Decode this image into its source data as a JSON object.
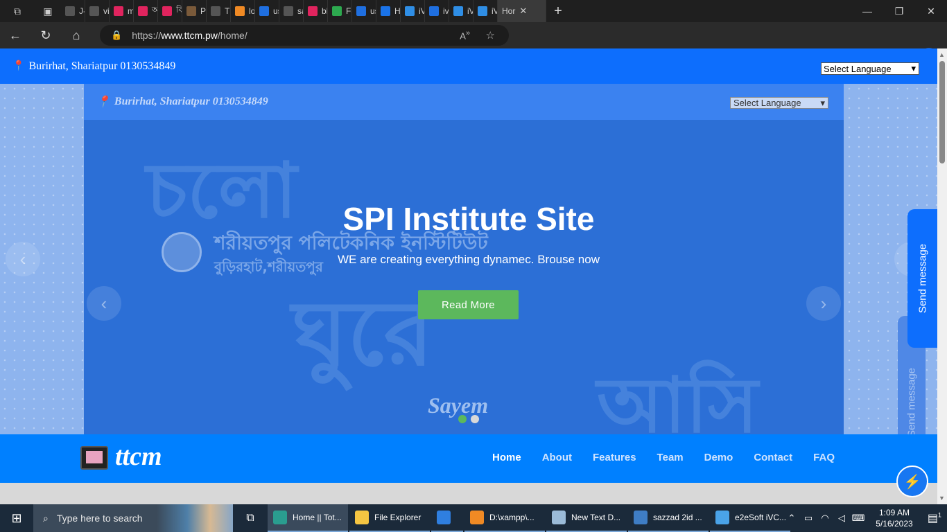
{
  "browser": {
    "tabs": [
      {
        "label": "J-SI",
        "icon": "document-icon",
        "color": "#555555"
      },
      {
        "label": "viev",
        "icon": "document-icon",
        "color": "#555555"
      },
      {
        "label": "mo",
        "icon": "arrow-logo-icon",
        "color": "#e0245e"
      },
      {
        "label": "অন",
        "icon": "arrow-logo-icon",
        "color": "#e0245e"
      },
      {
        "label": "বিব",
        "icon": "arrow-logo-icon",
        "color": "#e0245e"
      },
      {
        "label": "Pro",
        "icon": "circle-icon",
        "color": "#7a5a3a"
      },
      {
        "label": "This",
        "icon": "document-icon",
        "color": "#555555"
      },
      {
        "label": "loca",
        "icon": "xampp-icon",
        "color": "#f08a24"
      },
      {
        "label": "usir",
        "icon": "search-icon",
        "color": "#1f6fe0"
      },
      {
        "label": "sazz",
        "icon": "document-icon",
        "color": "#555555"
      },
      {
        "label": "bKa",
        "icon": "arrow-logo-icon",
        "color": "#e0245e"
      },
      {
        "label": "Fatl",
        "icon": "drive-icon",
        "color": "#2da94f"
      },
      {
        "label": "use",
        "icon": "search-icon",
        "color": "#1f6fe0"
      },
      {
        "label": "Hov",
        "icon": "t-logo-icon",
        "color": "#1a73e8"
      },
      {
        "label": "iVC",
        "icon": "e-logo-icon",
        "color": "#2f8ee5"
      },
      {
        "label": "ivca",
        "icon": "search-icon",
        "color": "#1f6fe0"
      },
      {
        "label": "iVC",
        "icon": "e-logo-icon",
        "color": "#2f8ee5"
      },
      {
        "label": "iVC",
        "icon": "e-logo-icon",
        "color": "#2f8ee5"
      }
    ],
    "active_tab": {
      "label": "Hor",
      "close": "✕"
    },
    "url_prefix": "https://",
    "url_host": "www.ttcm.pw",
    "url_path": "/home/"
  },
  "site": {
    "topline_address": "Burirhat, Shariatpur 0130534849",
    "language_select": "Select Language",
    "hero": {
      "inner_address": "Burirhat, Shariatpur 0130534849",
      "inner_language_select": "Select Language",
      "bg_glyph_1": "চলো",
      "bg_glyph_2": "ঘুরে",
      "bg_glyph_3": "আসি",
      "institute_bn": "শরীয়তপুর পলিটেকনিক ইনস্টিটিউট",
      "institute_place_bn": "বুড়িরহাট,শরীয়তপুর",
      "signature": "Sayem",
      "title": "SPI Institute Site",
      "subtitle": "WE are creating everything dynamec. Brouse now",
      "cta": "Read More",
      "active_slide": 1,
      "slide_count": 2
    },
    "send_message": "Send message",
    "brand": "ttcm",
    "nav": [
      "Home",
      "About",
      "Features",
      "Team",
      "Demo",
      "Contact",
      "FAQ"
    ],
    "nav_active": "Home"
  },
  "taskbar": {
    "search_placeholder": "Type here to search",
    "tasks": [
      {
        "label": "Home || Tot...",
        "color": "#2a9d8f",
        "active": true
      },
      {
        "label": "File Explorer",
        "color": "#f4c542",
        "active": false
      },
      {
        "label": "",
        "color": "#2f7fe0",
        "active": false
      },
      {
        "label": "D:\\xampp\\...",
        "color": "#f08a24",
        "active": false
      },
      {
        "label": "New Text D...",
        "color": "#9bbbd8",
        "active": false
      },
      {
        "label": "sazzad 2id ...",
        "color": "#3f7dc4",
        "active": false
      },
      {
        "label": "e2eSoft iVC...",
        "color": "#4aa3e8",
        "active": false
      }
    ],
    "time": "1:09 AM",
    "date": "5/16/2023",
    "notifications": "1"
  },
  "colors": {
    "brand_blue": "#0d6efd",
    "nav_blue": "#0080ff",
    "cta_green": "#5cb85c"
  }
}
